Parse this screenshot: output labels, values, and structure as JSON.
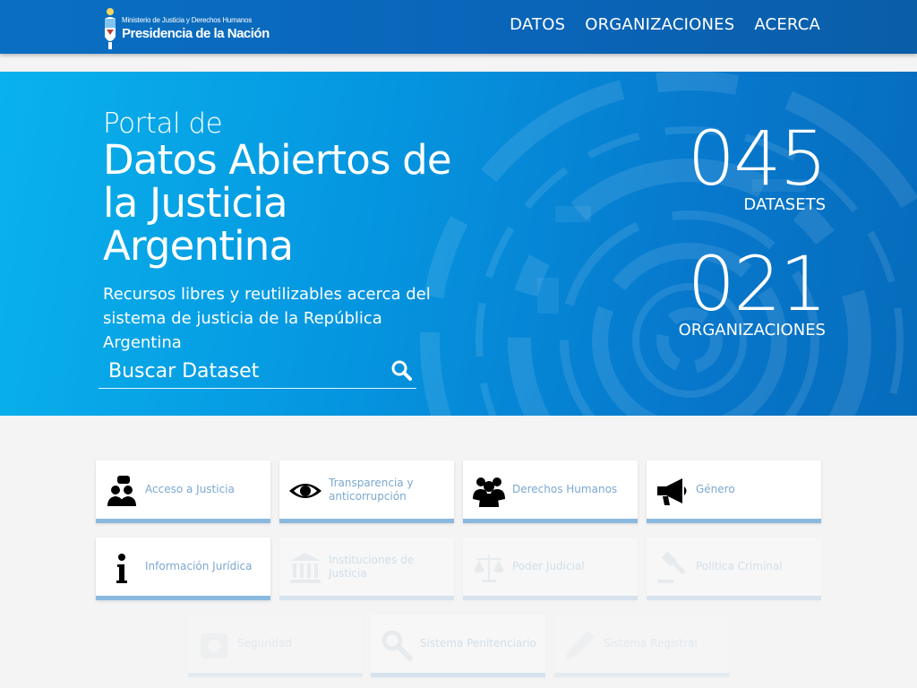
{
  "header": {
    "logo_small": "Ministerio de Justicia y Derechos Humanos",
    "logo_big": "Presidencia de la Nación",
    "nav": [
      {
        "label": "DATOS"
      },
      {
        "label": "ORGANIZACIONES"
      },
      {
        "label": "ACERCA"
      }
    ]
  },
  "hero": {
    "pre_title": "Portal de",
    "title": "Datos Abiertos de la Justicia Argentina",
    "description": "Recursos libres y reutilizables acerca del sistema de justicia de la República Argentina",
    "search_placeholder": "Buscar Dataset",
    "stats": [
      {
        "value": "045",
        "label": "DATASETS"
      },
      {
        "value": "021",
        "label": "ORGANIZACIONES"
      }
    ]
  },
  "categories": [
    {
      "label": "Acceso a Justicia",
      "icon": "people-chat-icon"
    },
    {
      "label": "Transparencia y anticorrupción",
      "icon": "eye-icon"
    },
    {
      "label": "Derechos Humanos",
      "icon": "group-icon"
    },
    {
      "label": "Género",
      "icon": "megaphone-icon"
    },
    {
      "label": "Información Jurídica",
      "icon": "info-icon"
    },
    {
      "label": "Instituciones de Justicia",
      "icon": "institution-icon"
    },
    {
      "label": "Poder Judicial",
      "icon": "scales-icon"
    },
    {
      "label": "Política Criminal",
      "icon": "gavel-icon"
    },
    {
      "label": "Seguridad",
      "icon": "safe-icon"
    },
    {
      "label": "Sistema Penitenciario",
      "icon": "search-icon"
    },
    {
      "label": "Sistema Registral",
      "icon": "pen-icon"
    }
  ],
  "colors": {
    "header": "#0a6fc2",
    "hero_start": "#09b2ec",
    "hero_end": "#066bbb",
    "card_bar": "#8ab9df",
    "card_text": "#7aa8d0",
    "icon": "#ccd7e2"
  }
}
